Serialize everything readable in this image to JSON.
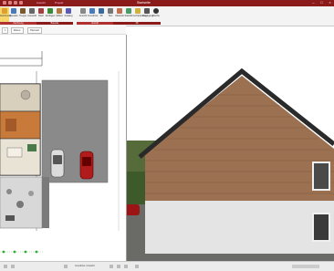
{
  "window": {
    "title": "Startseite",
    "tabs": [
      "Ansicht",
      "Projekt"
    ]
  },
  "ribbon": {
    "buttons": [
      {
        "label": "Zeichnung",
        "name": "zeichnung"
      },
      {
        "label": "Bauteile",
        "name": "bauteile"
      },
      {
        "label": "Treppe",
        "name": "treppe"
      },
      {
        "label": "Auswahl",
        "name": "auswahl"
      },
      {
        "label": "Dach",
        "name": "dach"
      },
      {
        "label": "Einfügen",
        "name": "einfuegen"
      },
      {
        "label": "Möbel",
        "name": "moebel"
      },
      {
        "label": "Katalog",
        "name": "katalog"
      },
      {
        "label": "Ansicht",
        "name": "ansicht"
      },
      {
        "label": "Grundriss",
        "name": "grundriss"
      },
      {
        "label": "3D",
        "name": "3d"
      },
      {
        "label": "Text",
        "name": "text"
      },
      {
        "label": "Material",
        "name": "material"
      },
      {
        "label": "Statistik",
        "name": "statistik"
      },
      {
        "label": "Lichtplanung",
        "name": "lichtplanung"
      },
      {
        "label": "Rundgang",
        "name": "rundgang"
      },
      {
        "label": "Fläche",
        "name": "flaeche"
      }
    ],
    "groups": [
      "Zeichnung",
      "Bauteile",
      "Ansicht",
      "3D"
    ],
    "accent": "#8b1a1a",
    "active": "#f6d66a"
  },
  "plan_toolbar": {
    "items": [
      "1",
      "Ebene",
      "Plansatz"
    ]
  },
  "statusbar": {
    "text": "Grundriss / Ansicht"
  }
}
